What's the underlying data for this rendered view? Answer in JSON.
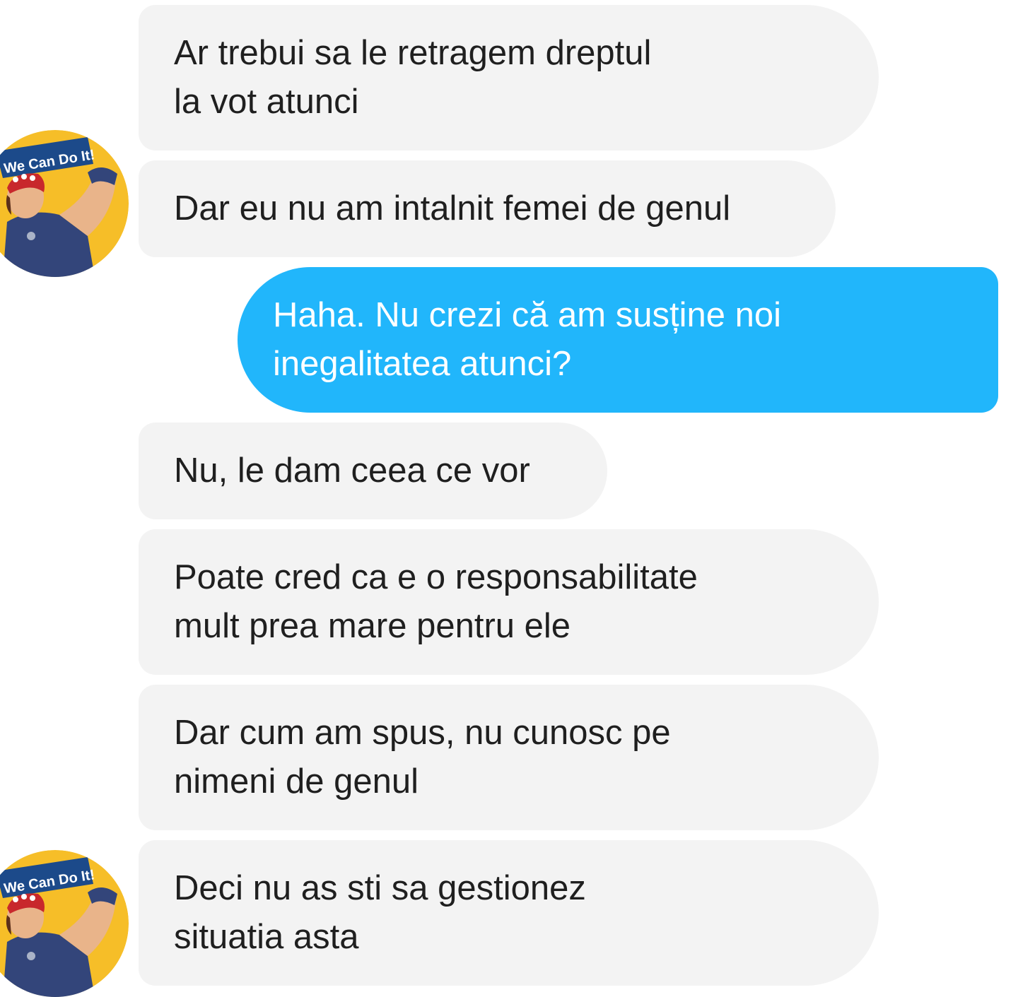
{
  "colors": {
    "incoming_bubble": "#f3f3f3",
    "outgoing_bubble": "#21b6fb",
    "incoming_text": "#1f1f1f",
    "outgoing_text": "#ffffff"
  },
  "avatar": {
    "caption": "We Can Do It!",
    "icon": "we-can-do-it-poster-avatar"
  },
  "messages": [
    {
      "direction": "incoming",
      "text": "Ar trebui sa le retragem dreptul\nla vot atunci"
    },
    {
      "direction": "incoming",
      "text": "Dar eu nu am intalnit femei de genul"
    },
    {
      "direction": "outgoing",
      "text": "Haha. Nu crezi că am susține noi\ninegalitatea atunci?"
    },
    {
      "direction": "incoming",
      "text": "Nu, le dam ceea ce vor"
    },
    {
      "direction": "incoming",
      "text": "Poate cred ca e o responsabilitate\nmult prea mare pentru ele"
    },
    {
      "direction": "incoming",
      "text": "Dar cum am spus, nu cunosc pe\nnimeni de genul"
    },
    {
      "direction": "incoming",
      "text": "Deci nu as sti sa gestionez\nsituatia asta"
    }
  ]
}
